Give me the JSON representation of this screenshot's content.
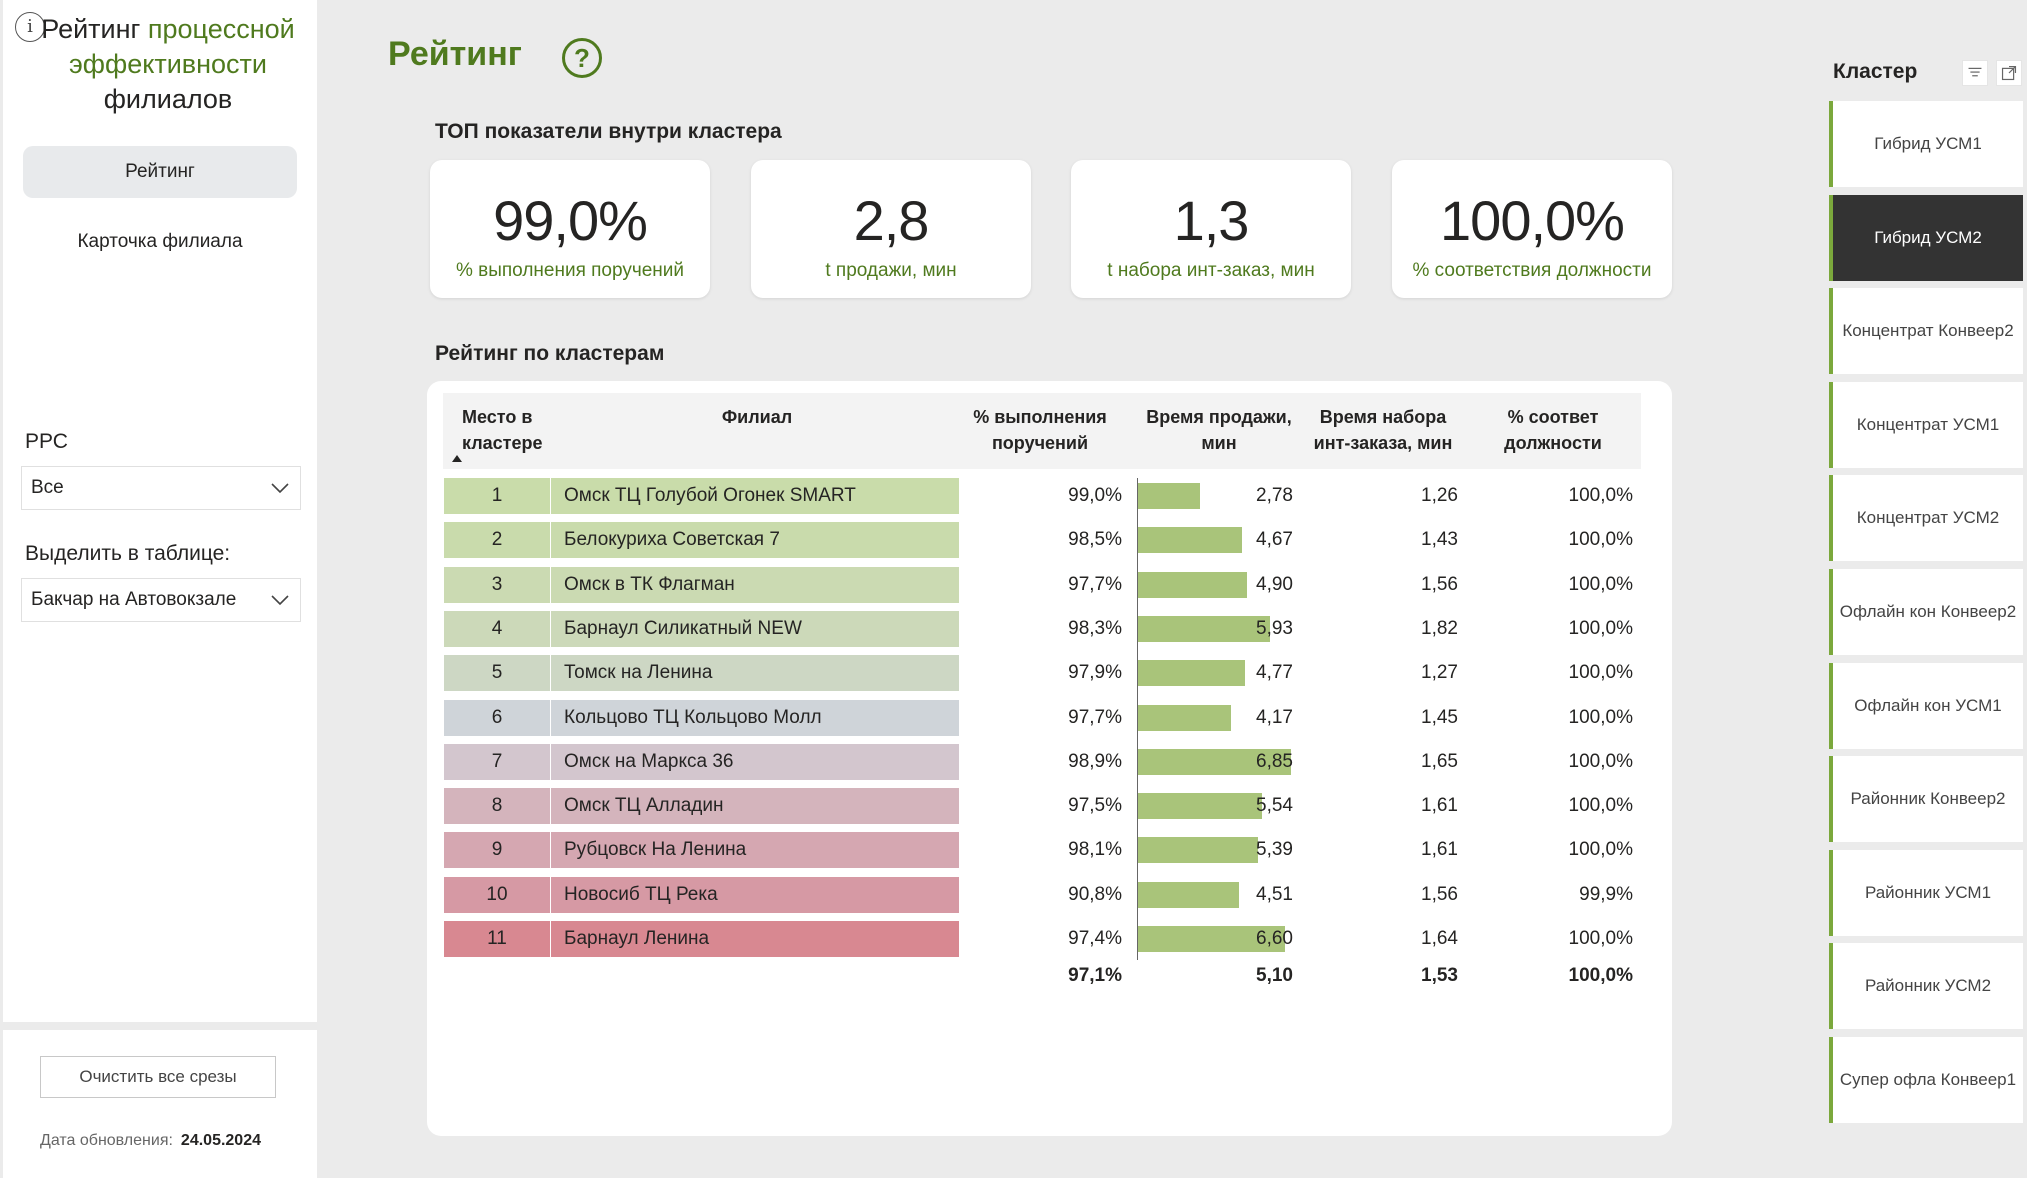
{
  "sidebar": {
    "title_part1": "Рейтинг ",
    "title_part2": "процессной эффективности",
    "title_part3": "филиалов",
    "nav": [
      {
        "label": "Рейтинг",
        "active": true
      },
      {
        "label": "Карточка филиала",
        "active": false
      }
    ],
    "rrs_label": "РРС",
    "rrs_value": "Все",
    "highlight_label": "Выделить в таблице:",
    "highlight_value": "Бакчар на Автовокзале",
    "clear_button": "Очистить все срезы",
    "update_label": "Дата обновления:",
    "update_date": "24.05.2024"
  },
  "header": {
    "title": "Рейтинг",
    "help_icon": "question-circle-icon",
    "accent_color": "#4f7a1e"
  },
  "kpi_section": {
    "title": "ТОП показатели внутри кластера",
    "cards": [
      {
        "value": "99,0%",
        "label": "% выполнения поручений"
      },
      {
        "value": "2,8",
        "label": "t продажи, мин"
      },
      {
        "value": "1,3",
        "label": "t набора инт-заказ, мин"
      },
      {
        "value": "100,0%",
        "label": "% соответствия должности"
      }
    ]
  },
  "table": {
    "title": "Рейтинг по кластерам",
    "headers": {
      "rank_line1": "Место в",
      "rank_line2": "кластере",
      "branch": "Филиал",
      "completion_line1": "% выполнения",
      "completion_line2": "поручений",
      "sale_time_line1": "Время продажи,",
      "sale_time_line2": "мин",
      "pick_time_line1": "Время набора",
      "pick_time_line2": "инт-заказа, мин",
      "position_line1": "% соответ",
      "position_line2": "должности"
    },
    "rows": [
      {
        "rank": "1",
        "branch": "Омск ТЦ Голубой Огонек SMART",
        "completion": "99,0%",
        "sale_time": "2,78",
        "sale_value": 2.78,
        "pick_time": "1,26",
        "position": "100,0%",
        "color": "#c9dcaa"
      },
      {
        "rank": "2",
        "branch": "Белокуриха Советская 7",
        "completion": "98,5%",
        "sale_time": "4,67",
        "sale_value": 4.67,
        "pick_time": "1,43",
        "position": "100,0%",
        "color": "#c9dbac"
      },
      {
        "rank": "3",
        "branch": "Омск в ТК Флагман",
        "completion": "97,7%",
        "sale_time": "4,90",
        "sale_value": 4.9,
        "pick_time": "1,56",
        "position": "100,0%",
        "color": "#cbdab2"
      },
      {
        "rank": "4",
        "branch": "Барнаул Силикатный NEW",
        "completion": "98,3%",
        "sale_time": "5,93",
        "sale_value": 5.93,
        "pick_time": "1,82",
        "position": "100,0%",
        "color": "#ccd9b9"
      },
      {
        "rank": "5",
        "branch": "Томск на Ленина",
        "completion": "97,9%",
        "sale_time": "4,77",
        "sale_value": 4.77,
        "pick_time": "1,27",
        "position": "100,0%",
        "color": "#cdd7c4"
      },
      {
        "rank": "6",
        "branch": "Кольцово ТЦ Кольцово Молл",
        "completion": "97,7%",
        "sale_time": "4,17",
        "sale_value": 4.17,
        "pick_time": "1,45",
        "position": "100,0%",
        "color": "#cfd4d9"
      },
      {
        "rank": "7",
        "branch": "Омск на Маркса 36",
        "completion": "98,9%",
        "sale_time": "6,85",
        "sale_value": 6.85,
        "pick_time": "1,65",
        "position": "100,0%",
        "color": "#d3c6ce"
      },
      {
        "rank": "8",
        "branch": "Омск ТЦ Алладин",
        "completion": "97,5%",
        "sale_time": "5,54",
        "sale_value": 5.54,
        "pick_time": "1,61",
        "position": "100,0%",
        "color": "#d4b4bc"
      },
      {
        "rank": "9",
        "branch": "Рубцовск На Ленина",
        "completion": "98,1%",
        "sale_time": "5,39",
        "sale_value": 5.39,
        "pick_time": "1,61",
        "position": "100,0%",
        "color": "#d5a7b1"
      },
      {
        "rank": "10",
        "branch": "Новосиб ТЦ Река",
        "completion": "90,8%",
        "sale_time": "4,51",
        "sale_value": 4.51,
        "pick_time": "1,56",
        "position": "99,9%",
        "color": "#d699a4"
      },
      {
        "rank": "11",
        "branch": "Барнаул Ленина",
        "completion": "97,4%",
        "sale_time": "6,60",
        "sale_value": 6.6,
        "pick_time": "1,64",
        "position": "100,0%",
        "color": "#d88891"
      }
    ],
    "totals": {
      "completion": "97,1%",
      "sale_time": "5,10",
      "pick_time": "1,53",
      "position": "100,0%"
    },
    "bar_color": "#a9c47a",
    "bar_max": 6.85
  },
  "cluster_slicer": {
    "title": "Кластер",
    "tools": [
      "filter-icon",
      "focus-mode-icon"
    ],
    "items": [
      {
        "label": "Гибрид УСМ1",
        "selected": false
      },
      {
        "label": "Гибрид УСМ2",
        "selected": true
      },
      {
        "label": "Концентрат Конвеер2",
        "selected": false
      },
      {
        "label": "Концентрат УСМ1",
        "selected": false
      },
      {
        "label": "Концентрат УСМ2",
        "selected": false
      },
      {
        "label": "Офлайн кон Конвеер2",
        "selected": false
      },
      {
        "label": "Офлайн кон УСМ1",
        "selected": false
      },
      {
        "label": "Районник Конвеер2",
        "selected": false
      },
      {
        "label": "Районник УСМ1",
        "selected": false
      },
      {
        "label": "Районник УСМ2",
        "selected": false
      },
      {
        "label": "Супер офла Конвеер1",
        "selected": false
      }
    ],
    "accent_color": "#7ba83c",
    "selected_color": "#333333"
  }
}
